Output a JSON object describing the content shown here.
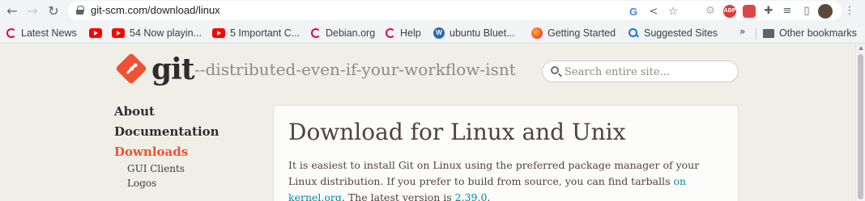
{
  "browser": {
    "url": "git-scm.com/download/linux",
    "bookmarks": [
      {
        "label": "Latest News",
        "icon": "debian-swirl-icon"
      },
      {
        "label": "",
        "icon": "youtube-icon"
      },
      {
        "label": "54 Now playin...",
        "icon": "youtube-icon"
      },
      {
        "label": "5 Important C...",
        "icon": "youtube-icon"
      },
      {
        "label": "Debian.org",
        "icon": "debian-swirl-icon"
      },
      {
        "label": "Help",
        "icon": "debian-swirl-icon"
      },
      {
        "label": "ubuntu Bluet...",
        "icon": "wordpress-icon"
      },
      {
        "label": "Getting Started",
        "icon": "firefox-icon"
      },
      {
        "label": "Suggested Sites",
        "icon": "search-icon"
      }
    ],
    "more_bookmarks": "»",
    "other_bookmarks": "Other bookmarks",
    "google_letter": "G",
    "abp_label": "ABP"
  },
  "site": {
    "logo_text": "git",
    "tagline": "--distributed-even-if-your-workflow-isnt",
    "search_placeholder": "Search entire site..."
  },
  "sidebar": {
    "items": [
      {
        "label": "About",
        "active": false
      },
      {
        "label": "Documentation",
        "active": false
      },
      {
        "label": "Downloads",
        "active": true
      }
    ],
    "sub_items": [
      "GUI Clients",
      "Logos"
    ]
  },
  "content": {
    "title": "Download for Linux and Unix",
    "intro_part1": "It is easiest to install Git on Linux using the preferred package manager of your Linux distribution. If you prefer to build from source, you can find tarballs ",
    "intro_link": "on kernel.org",
    "intro_part2": ". The latest version is ",
    "version_link": "2.39.0",
    "intro_part3": "."
  },
  "colors": {
    "brand": "#f05033",
    "link": "#0388a6",
    "page_bg": "#f0efe7"
  }
}
